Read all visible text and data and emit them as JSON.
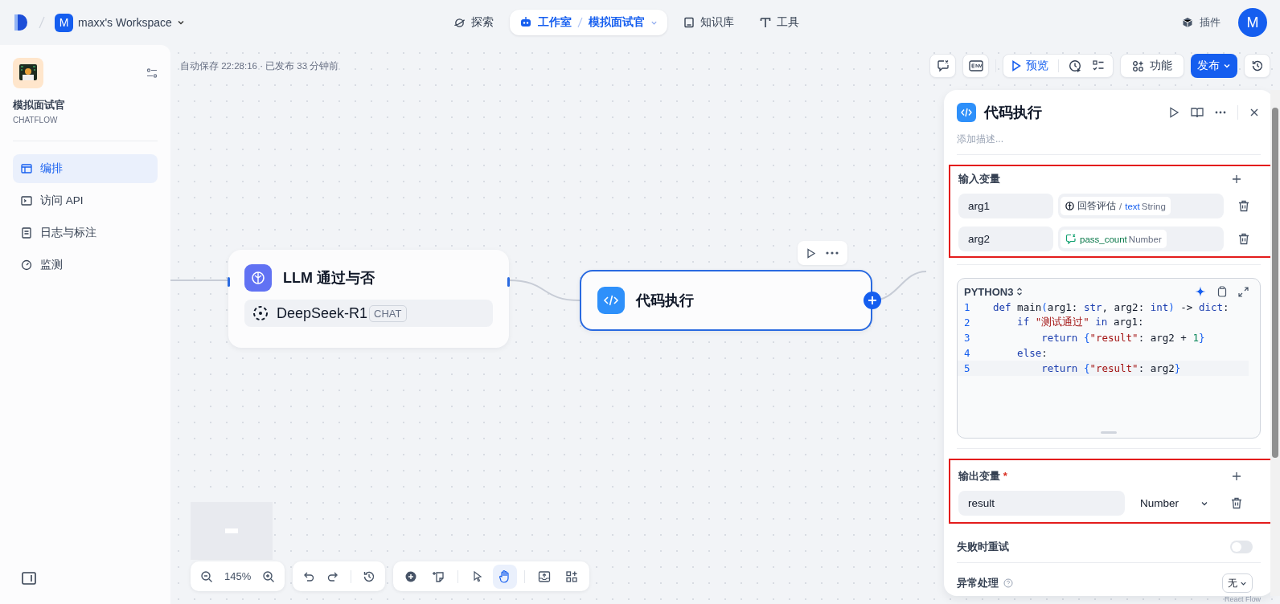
{
  "topbar": {
    "workspace": {
      "initial": "M",
      "name": "maxx's Workspace"
    },
    "nav": [
      {
        "kind": "explore",
        "label": "探索",
        "selected": false
      },
      {
        "kind": "studio",
        "label": "工作室",
        "sub": "模拟面试官",
        "selected": true
      },
      {
        "kind": "knowledge",
        "label": "知识库",
        "selected": false
      },
      {
        "kind": "tools",
        "label": "工具",
        "selected": false
      }
    ],
    "plugins": "插件",
    "avatar": "M"
  },
  "sidebar": {
    "app": {
      "name": "模拟面试官",
      "type": "CHATFLOW"
    },
    "items": [
      {
        "kind": "orchestrate",
        "label": "编排",
        "selected": true
      },
      {
        "kind": "api",
        "label": "访问 API",
        "selected": false
      },
      {
        "kind": "logs",
        "label": "日志与标注",
        "selected": false
      },
      {
        "kind": "monitor",
        "label": "监测",
        "selected": false
      }
    ]
  },
  "canvas": {
    "status": "自动保存 22:28:16 · 已发布 33 分钟前",
    "toolbar": {
      "preview": "预览",
      "features": "功能",
      "publish": "发布"
    },
    "nodes": [
      {
        "kind": "llm",
        "title": "LLM 通过与否",
        "model": "DeepSeek-R1",
        "tag": "CHAT",
        "selected": false
      },
      {
        "kind": "code",
        "title": "代码执行",
        "selected": true
      }
    ],
    "zoom": "145%",
    "tools": [
      {
        "kind": "add",
        "selected": false
      },
      {
        "kind": "note",
        "selected": false
      },
      {
        "kind": "pointer",
        "selected": false
      },
      {
        "kind": "hand",
        "selected": true
      },
      {
        "kind": "export",
        "selected": false
      },
      {
        "kind": "organize",
        "selected": false
      }
    ],
    "attribution": "React Flow"
  },
  "panel": {
    "title": "代码执行",
    "description_placeholder": "添加描述...",
    "inputs": {
      "title": "输入变量",
      "vars": [
        {
          "name": "arg1",
          "kind": "llm",
          "node": "回答评估",
          "separator": "/",
          "var": "text",
          "type": "String"
        },
        {
          "name": "arg2",
          "kind": "variable",
          "var": "pass_count",
          "type": "Number"
        }
      ]
    },
    "code": {
      "language": "PYTHON3",
      "lines": [
        {
          "no": "1",
          "code": "def main(arg1: str, arg2: int) -> dict:"
        },
        {
          "no": "2",
          "code": "    if \"测试通过\" in arg1:"
        },
        {
          "no": "3",
          "code": "        return {\"result\": arg2 + 1}"
        },
        {
          "no": "4",
          "code": "    else:"
        },
        {
          "no": "5",
          "code": "        return {\"result\": arg2}"
        }
      ]
    },
    "outputs": {
      "title": "输出变量",
      "required_mark": "*",
      "vars": [
        {
          "name": "result",
          "type": "Number"
        }
      ]
    },
    "retry": {
      "label": "失败时重试",
      "on": false
    },
    "error": {
      "label": "异常处理",
      "value": "无"
    }
  }
}
